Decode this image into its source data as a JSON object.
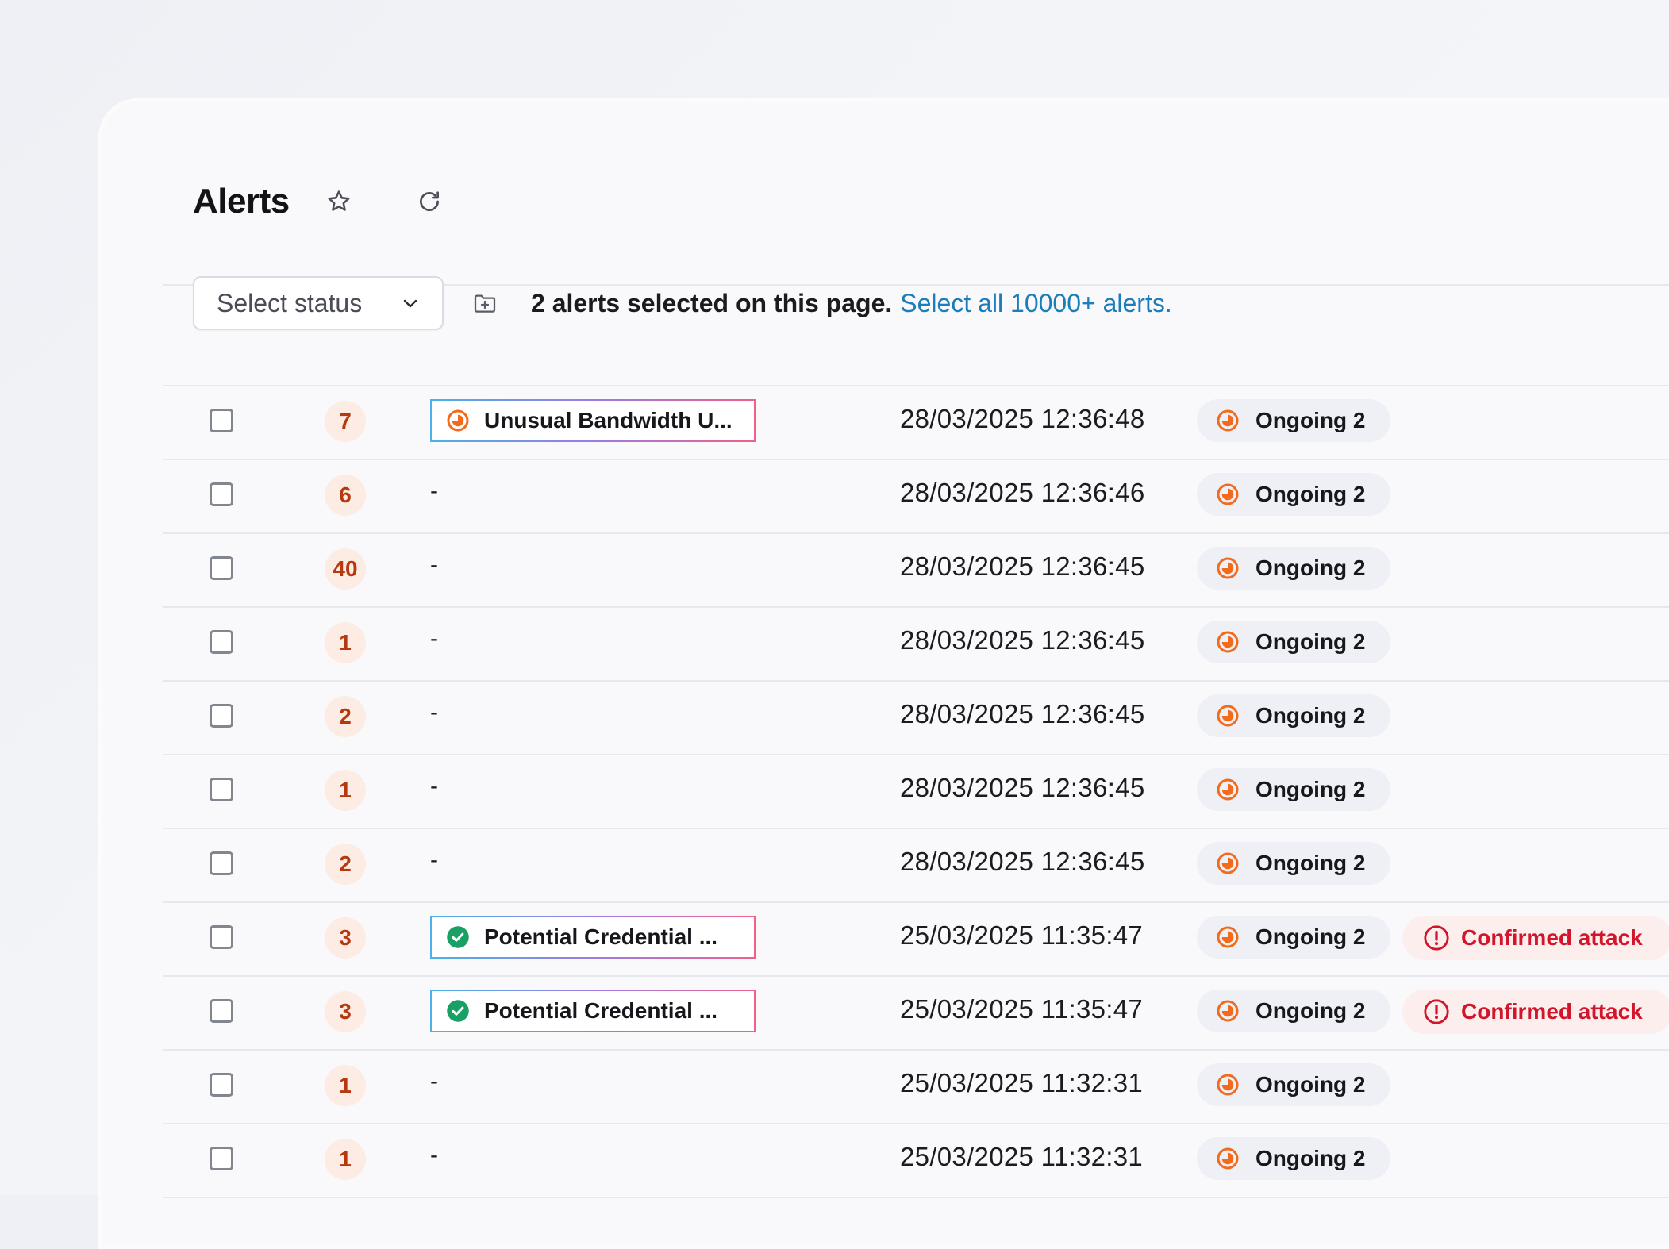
{
  "header": {
    "title": "Alerts"
  },
  "toolbar": {
    "select_placeholder": "Select status",
    "selection_text": "2 alerts selected on this page.",
    "select_all_link": "Select all 10000+ alerts."
  },
  "colors": {
    "accent_link": "#1c7dbb",
    "count_badge_bg": "#fdece3",
    "count_badge_text": "#b5380f",
    "status_ongoing_icon": "#f26b1d",
    "status_resolved_icon": "#18a065",
    "attack_text": "#d2152a",
    "attack_bg": "#fdeeee"
  },
  "rows": [
    {
      "count": "7",
      "name": "Unusual Bandwidth U...",
      "name_icon": "ongoing-icon",
      "time": "28/03/2025 12:36:48",
      "status": "Ongoing 2",
      "tag": ""
    },
    {
      "count": "6",
      "name": "-",
      "name_icon": "",
      "time": "28/03/2025 12:36:46",
      "status": "Ongoing 2",
      "tag": ""
    },
    {
      "count": "40",
      "name": "-",
      "name_icon": "",
      "time": "28/03/2025 12:36:45",
      "status": "Ongoing 2",
      "tag": ""
    },
    {
      "count": "1",
      "name": "-",
      "name_icon": "",
      "time": "28/03/2025 12:36:45",
      "status": "Ongoing 2",
      "tag": ""
    },
    {
      "count": "2",
      "name": "-",
      "name_icon": "",
      "time": "28/03/2025 12:36:45",
      "status": "Ongoing 2",
      "tag": ""
    },
    {
      "count": "1",
      "name": "-",
      "name_icon": "",
      "time": "28/03/2025 12:36:45",
      "status": "Ongoing 2",
      "tag": ""
    },
    {
      "count": "2",
      "name": "-",
      "name_icon": "",
      "time": "28/03/2025 12:36:45",
      "status": "Ongoing 2",
      "tag": ""
    },
    {
      "count": "3",
      "name": "Potential Credential ...",
      "name_icon": "check-circle-icon",
      "time": "25/03/2025 11:35:47",
      "status": "Ongoing 2",
      "tag": "Confirmed attack"
    },
    {
      "count": "3",
      "name": "Potential Credential ...",
      "name_icon": "check-circle-icon",
      "time": "25/03/2025 11:35:47",
      "status": "Ongoing 2",
      "tag": "Confirmed attack"
    },
    {
      "count": "1",
      "name": "-",
      "name_icon": "",
      "time": "25/03/2025 11:32:31",
      "status": "Ongoing 2",
      "tag": ""
    },
    {
      "count": "1",
      "name": "-",
      "name_icon": "",
      "time": "25/03/2025 11:32:31",
      "status": "Ongoing 2",
      "tag": ""
    }
  ]
}
